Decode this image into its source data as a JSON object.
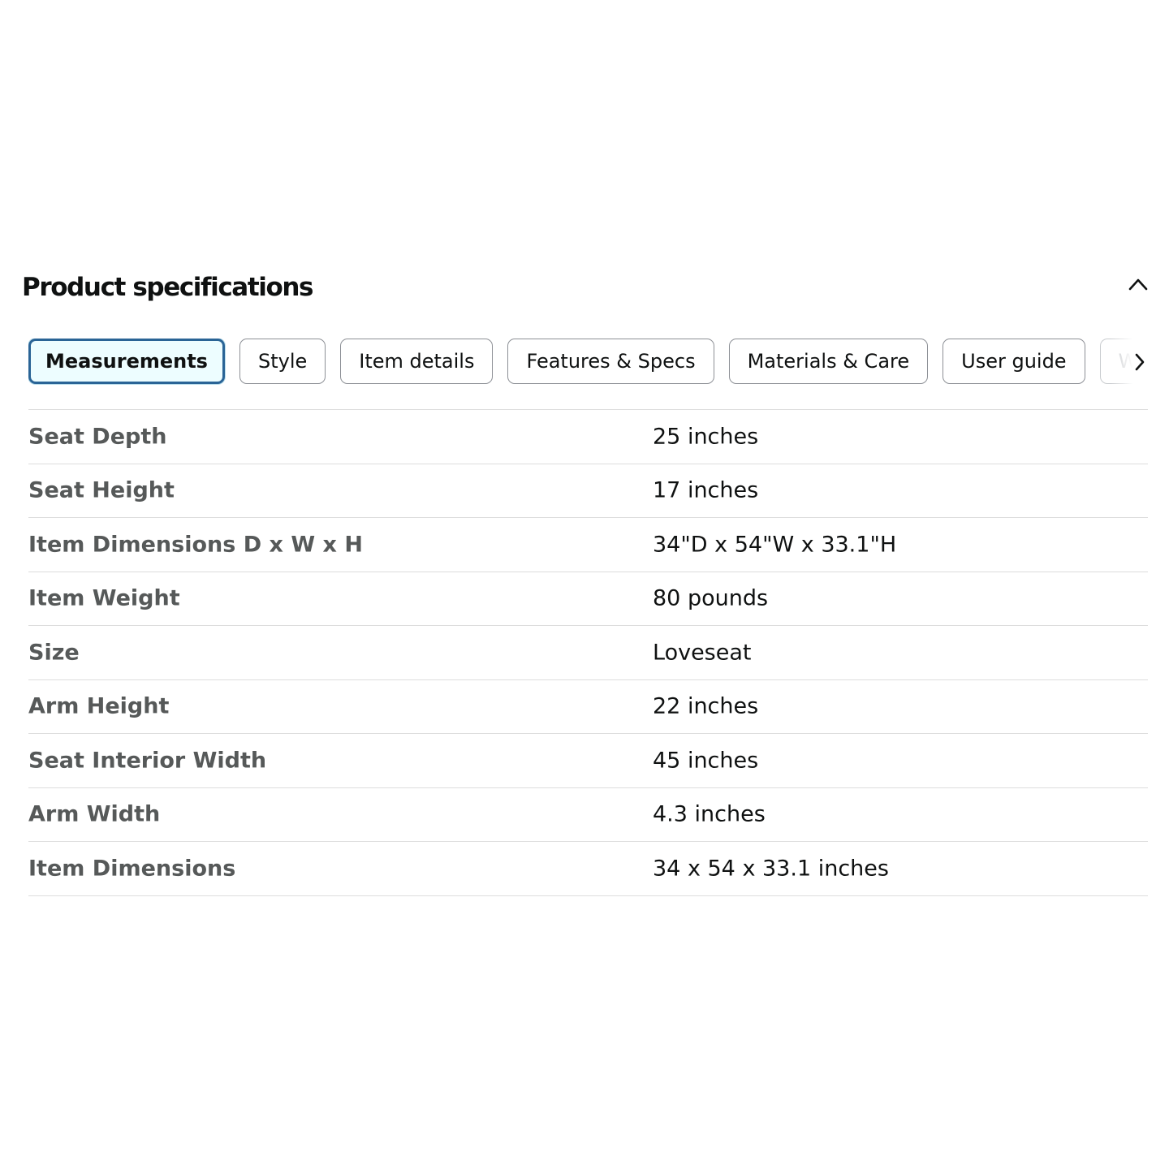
{
  "section": {
    "title": "Product specifications",
    "collapse_icon": "chevron-up-icon"
  },
  "tabs": [
    {
      "label": "Measurements",
      "active": true
    },
    {
      "label": "Style",
      "active": false
    },
    {
      "label": "Item details",
      "active": false
    },
    {
      "label": "Features & Specs",
      "active": false
    },
    {
      "label": "Materials & Care",
      "active": false
    },
    {
      "label": "User guide",
      "active": false
    },
    {
      "label": "Wa",
      "active": false
    }
  ],
  "tabs_scroll_icon": "chevron-right-icon",
  "colors": {
    "active_tab_border": "#2a6496",
    "active_tab_bg": "#edfdff",
    "key_text": "#565959",
    "value_text": "#0f1111",
    "divider": "#dddddd"
  },
  "specs": [
    {
      "key": "Seat Depth",
      "value": "25 inches"
    },
    {
      "key": "Seat Height",
      "value": "17 inches"
    },
    {
      "key": "Item Dimensions D x W x H",
      "value": "34\"D x 54\"W x 33.1\"H"
    },
    {
      "key": "Item Weight",
      "value": "80 pounds"
    },
    {
      "key": "Size",
      "value": "Loveseat"
    },
    {
      "key": "Arm Height",
      "value": "22 inches"
    },
    {
      "key": "Seat Interior Width",
      "value": "45 inches"
    },
    {
      "key": "Arm Width",
      "value": "4.3 inches"
    },
    {
      "key": "Item Dimensions",
      "value": "34 x 54 x 33.1 inches"
    }
  ]
}
